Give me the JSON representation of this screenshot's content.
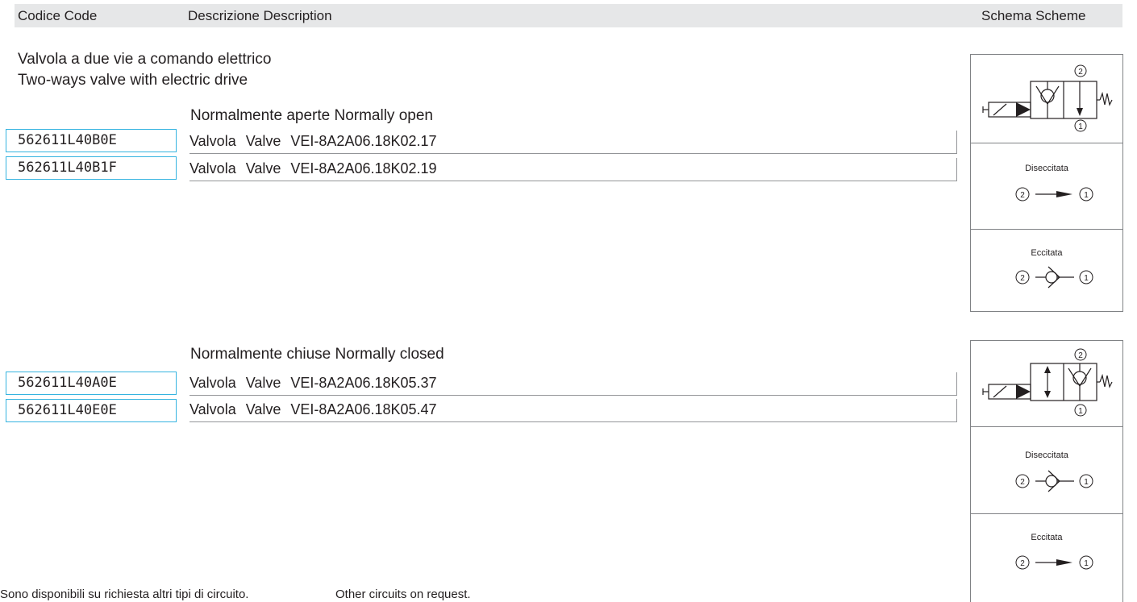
{
  "header": {
    "code_label": "Codice   Code",
    "description_label": "Descrizione   Description",
    "scheme_label": "Schema   Scheme"
  },
  "section": {
    "title_it": "Valvola a due vie a comando elettrico",
    "title_en": "Two-ways valve with electric drive"
  },
  "groups": [
    {
      "title": "Normalmente aperte    Normally open",
      "rows": [
        {
          "code": "562611L40B0E",
          "type_it": "Valvola",
          "type_en": "Valve",
          "model": "VEI-8A2A06.18K02.17"
        },
        {
          "code": "562611L40B1F",
          "type_it": "Valvola",
          "type_en": "Valve",
          "model": "VEI-8A2A06.18K02.19"
        }
      ],
      "scheme": {
        "port_top": "2",
        "port_bottom": "1",
        "deenergized_label": "Diseccitata",
        "energized_label": "Eccitata",
        "port_left": "2",
        "port_right": "1"
      }
    },
    {
      "title": "Normalmente chiuse    Normally closed",
      "rows": [
        {
          "code": "562611L40A0E",
          "type_it": "Valvola",
          "type_en": "Valve",
          "model": "VEI-8A2A06.18K05.37"
        },
        {
          "code": "562611L40E0E",
          "type_it": "Valvola",
          "type_en": "Valve",
          "model": "VEI-8A2A06.18K05.47"
        }
      ],
      "scheme": {
        "port_top": "2",
        "port_bottom": "1",
        "deenergized_label": "Diseccitata",
        "energized_label": "Eccitata",
        "port_left": "2",
        "port_right": "1"
      }
    }
  ],
  "footer": {
    "note_it": "Sono disponibili su richiesta altri tipi di circuito.",
    "note_en": "Other circuits on request."
  }
}
